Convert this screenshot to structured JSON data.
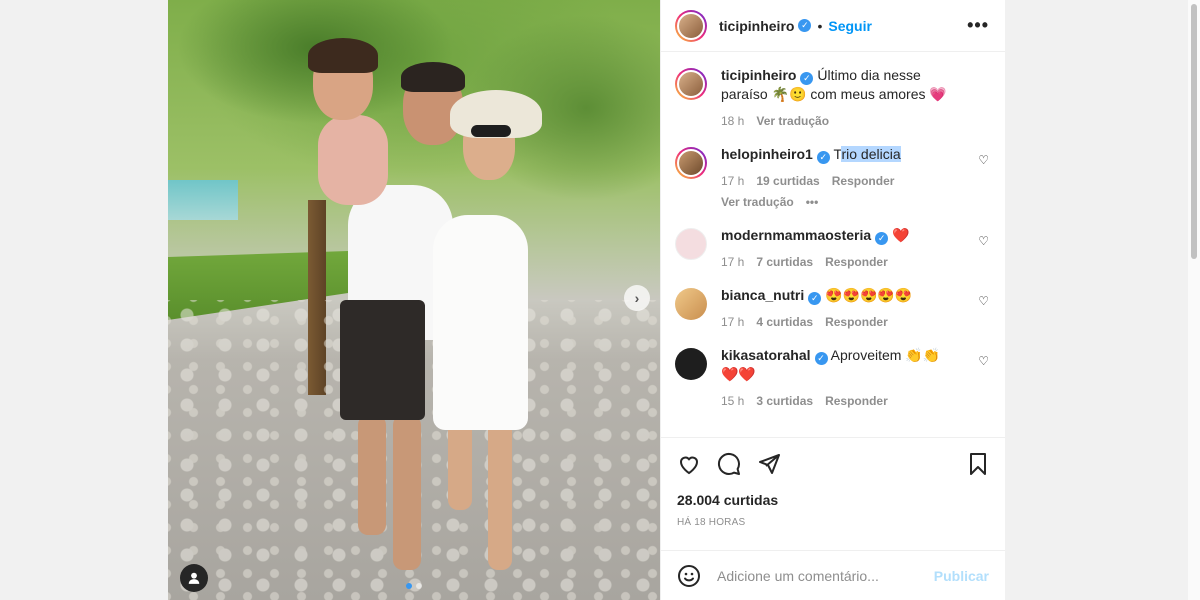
{
  "post": {
    "author": "ticipinheiro",
    "follow_label": "Seguir",
    "separator": "•",
    "more_label": "•••"
  },
  "caption": {
    "username": "ticipinheiro",
    "text": "Último dia nesse paraíso 🌴🙂 com meus amores 💗",
    "time": "18 h",
    "translate": "Ver tradução"
  },
  "comments": [
    {
      "username": "helopinheiro1",
      "text_pre": "T",
      "text_hl": "rio delicia",
      "time": "17 h",
      "likes": "19 curtidas",
      "reply": "Responder",
      "translate": "Ver tradução",
      "more": "•••"
    },
    {
      "username": "modernmammaosteria",
      "text": "❤️",
      "time": "17 h",
      "likes": "7 curtidas",
      "reply": "Responder"
    },
    {
      "username": "bianca_nutri",
      "text": "😍😍😍😍😍",
      "time": "17 h",
      "likes": "4 curtidas",
      "reply": "Responder"
    },
    {
      "username": "kikasatorahal",
      "text": "Aproveitem 👏👏 ❤️❤️",
      "time": "15 h",
      "likes": "3 curtidas",
      "reply": "Responder"
    }
  ],
  "stats": {
    "likes": "28.004 curtidas",
    "posted": "HÁ 18 HORAS"
  },
  "add_comment": {
    "placeholder": "Adicione um comentário...",
    "publish": "Publicar"
  },
  "colors": {
    "accent": "#0095f6",
    "verified": "#3897f0",
    "muted": "#8e8e8e"
  }
}
